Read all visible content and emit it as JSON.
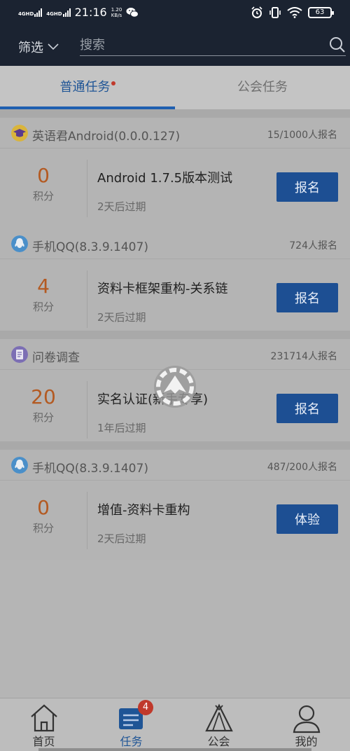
{
  "status_bar": {
    "network1": "4GHD",
    "network2": "4GHD",
    "time": "21:16",
    "speed_value": "1.20",
    "speed_unit": "KB/s",
    "battery": "63"
  },
  "header": {
    "filter_label": "筛选",
    "search_placeholder": "搜索"
  },
  "tabs": [
    {
      "label": "普通任务",
      "active": true
    },
    {
      "label": "公会任务",
      "active": false
    }
  ],
  "tasks": [
    {
      "app_name": "英语君Android(0.0.0.127)",
      "signups": "15/1000人报名",
      "points": "0",
      "points_label": "积分",
      "title": "Android 1.7.5版本测试",
      "expiry": "2天后过期",
      "action": "报名"
    },
    {
      "app_name": "手机QQ(8.3.9.1407)",
      "signups": "724人报名",
      "points": "4",
      "points_label": "积分",
      "title": "资料卡框架重构-关系链",
      "expiry": "2天后过期",
      "action": "报名"
    },
    {
      "app_name": "问卷调查",
      "signups": "231714人报名",
      "points": "20",
      "points_label": "积分",
      "title": "实名认证(新手专享)",
      "expiry": "1年后过期",
      "action": "报名"
    },
    {
      "app_name": "手机QQ(8.3.9.1407)",
      "signups": "487/200人报名",
      "points": "0",
      "points_label": "积分",
      "title": "增值-资料卡重构",
      "expiry": "2天后过期",
      "action": "体验"
    }
  ],
  "bottom_nav": [
    {
      "label": "首页",
      "icon": "home-icon"
    },
    {
      "label": "任务",
      "icon": "tasks-icon",
      "badge": "4",
      "active": true
    },
    {
      "label": "公会",
      "icon": "tent-icon"
    },
    {
      "label": "我的",
      "icon": "profile-icon"
    }
  ],
  "colors": {
    "header_bg": "#1b2331",
    "accent": "#1f5fb0",
    "points": "#b35a22",
    "badge": "#c0392b"
  }
}
